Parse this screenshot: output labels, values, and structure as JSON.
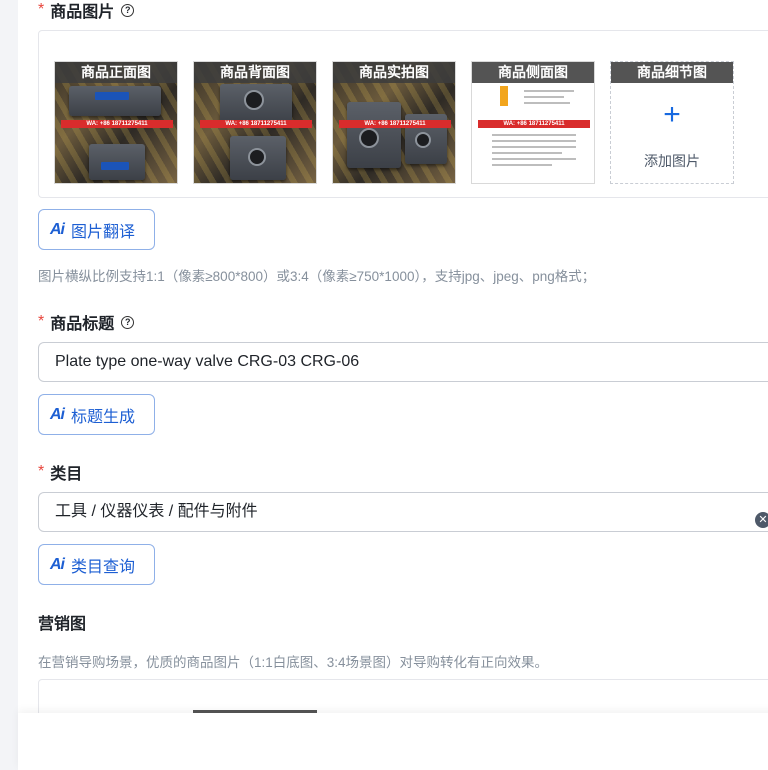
{
  "product_images": {
    "label": "商品图片",
    "required_mark": "*",
    "help_icon": "question-circle-icon",
    "tiles": [
      {
        "caption": "商品正面图",
        "watermark": "WA: +86 18711275411"
      },
      {
        "caption": "商品背面图",
        "watermark": "WA: +86 18711275411"
      },
      {
        "caption": "商品实拍图",
        "watermark": "WA: +86 18711275411"
      },
      {
        "caption": "商品侧面图",
        "watermark": "WA: +86 18711275411"
      },
      {
        "caption": "商品细节图",
        "add_icon": "plus-icon",
        "add_label": "添加图片"
      }
    ],
    "ai_button": {
      "icon": "Ai",
      "label": "图片翻译"
    },
    "hint": "图片横纵比例支持1:1（像素≥800*800）或3:4（像素≥750*1000），支持jpg、jpeg、png格式；"
  },
  "product_title": {
    "label": "商品标题",
    "required_mark": "*",
    "help_icon": "question-circle-icon",
    "value": "Plate type one-way valve CRG-03 CRG-06",
    "ai_button": {
      "icon": "Ai",
      "label": "标题生成"
    }
  },
  "category": {
    "label": "类目",
    "required_mark": "*",
    "value": "工具 / 仪器仪表 / 配件与附件",
    "clear_icon": "clear-circle-icon",
    "ai_button": {
      "icon": "Ai",
      "label": "类目查询"
    }
  },
  "marketing_image": {
    "label": "营销图",
    "hint": "在营销导购场景，优质的商品图片（1:1白底图、3:4场景图）对导购转化有正向效果。"
  },
  "colors": {
    "accent": "#1d5fd3",
    "required": "#e8453c",
    "hint_text": "#86909c",
    "border": "#c9cdd4"
  }
}
